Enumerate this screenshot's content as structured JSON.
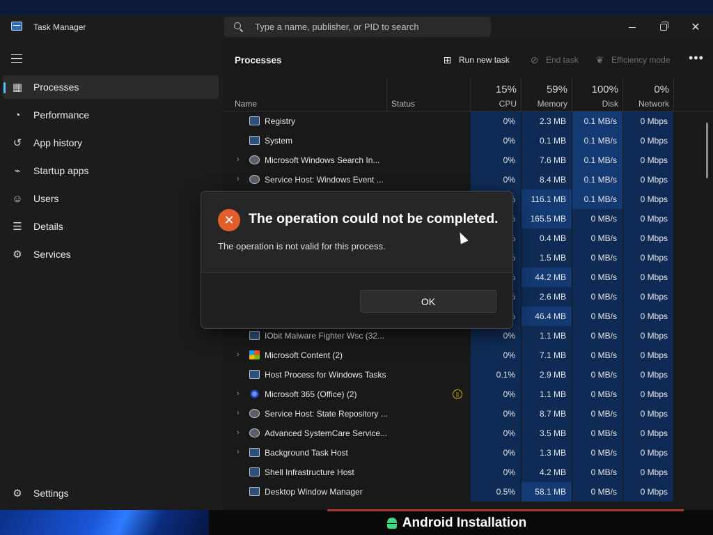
{
  "window": {
    "title": "Task Manager",
    "search_placeholder": "Type a name, publisher, or PID to search"
  },
  "sidebar": {
    "items": [
      {
        "label": "Processes",
        "icon": "processes-icon",
        "active": true
      },
      {
        "label": "Performance",
        "icon": "performance-icon"
      },
      {
        "label": "App history",
        "icon": "history-icon"
      },
      {
        "label": "Startup apps",
        "icon": "startup-icon"
      },
      {
        "label": "Users",
        "icon": "users-icon"
      },
      {
        "label": "Details",
        "icon": "details-icon"
      },
      {
        "label": "Services",
        "icon": "services-icon"
      }
    ],
    "settings_label": "Settings"
  },
  "toolbar": {
    "title": "Processes",
    "run_new_task": "Run new task",
    "end_task": "End task",
    "efficiency_mode": "Efficiency mode"
  },
  "table": {
    "headers": {
      "name": "Name",
      "status": "Status",
      "cpu_pct": "15%",
      "cpu": "CPU",
      "memory_pct": "59%",
      "memory": "Memory",
      "disk_pct": "100%",
      "disk": "Disk",
      "network_pct": "0%",
      "network": "Network"
    },
    "rows": [
      {
        "name": "Registry",
        "expand": false,
        "icon": "window",
        "cpu": "0%",
        "mem": "2.3 MB",
        "disk": "0.1 MB/s",
        "net": "0 Mbps"
      },
      {
        "name": "System",
        "expand": false,
        "icon": "window",
        "cpu": "0%",
        "mem": "0.1 MB",
        "disk": "0.1 MB/s",
        "net": "0 Mbps"
      },
      {
        "name": "Microsoft Windows Search In...",
        "expand": true,
        "icon": "gear",
        "cpu": "0%",
        "mem": "7.6 MB",
        "disk": "0.1 MB/s",
        "net": "0 Mbps"
      },
      {
        "name": "Service Host: Windows Event ...",
        "expand": true,
        "icon": "gear",
        "cpu": "0%",
        "mem": "8.4 MB",
        "disk": "0.1 MB/s",
        "net": "0 Mbps"
      },
      {
        "name": "",
        "expand": false,
        "icon": "none",
        "cpu": "%",
        "mem": "116.1 MB",
        "disk": "0.1 MB/s",
        "net": "0 Mbps"
      },
      {
        "name": "",
        "expand": false,
        "icon": "none",
        "cpu": "%",
        "mem": "165.5 MB",
        "disk": "0 MB/s",
        "net": "0 Mbps"
      },
      {
        "name": "",
        "expand": false,
        "icon": "none",
        "cpu": "%",
        "mem": "0.4 MB",
        "disk": "0 MB/s",
        "net": "0 Mbps"
      },
      {
        "name": "",
        "expand": false,
        "icon": "none",
        "cpu": "%",
        "mem": "1.5 MB",
        "disk": "0 MB/s",
        "net": "0 Mbps"
      },
      {
        "name": "",
        "expand": false,
        "icon": "none",
        "cpu": "%",
        "mem": "44.2 MB",
        "disk": "0 MB/s",
        "net": "0 Mbps"
      },
      {
        "name": "",
        "expand": false,
        "icon": "none",
        "cpu": "%",
        "mem": "2.6 MB",
        "disk": "0 MB/s",
        "net": "0 Mbps"
      },
      {
        "name": "",
        "expand": false,
        "icon": "none",
        "cpu": "%",
        "mem": "46.4 MB",
        "disk": "0 MB/s",
        "net": "0 Mbps"
      },
      {
        "name": "IObit Malware Fighter Wsc (32...",
        "expand": false,
        "icon": "window",
        "cpu": "0%",
        "mem": "1.1 MB",
        "disk": "0 MB/s",
        "net": "0 Mbps"
      },
      {
        "name": "Microsoft Content (2)",
        "expand": true,
        "icon": "ms",
        "cpu": "0%",
        "mem": "7.1 MB",
        "disk": "0 MB/s",
        "net": "0 Mbps"
      },
      {
        "name": "Host Process for Windows Tasks",
        "expand": false,
        "icon": "window",
        "cpu": "0.1%",
        "mem": "2.9 MB",
        "disk": "0 MB/s",
        "net": "0 Mbps"
      },
      {
        "name": "Microsoft 365 (Office) (2)",
        "expand": true,
        "icon": "o365",
        "status_icon": true,
        "cpu": "0%",
        "mem": "1.1 MB",
        "disk": "0 MB/s",
        "net": "0 Mbps"
      },
      {
        "name": "Service Host: State Repository ...",
        "expand": true,
        "icon": "gear",
        "cpu": "0%",
        "mem": "8.7 MB",
        "disk": "0 MB/s",
        "net": "0 Mbps"
      },
      {
        "name": "Advanced SystemCare Service...",
        "expand": true,
        "icon": "gear",
        "cpu": "0%",
        "mem": "3.5 MB",
        "disk": "0 MB/s",
        "net": "0 Mbps"
      },
      {
        "name": "Background Task Host",
        "expand": true,
        "icon": "window",
        "cpu": "0%",
        "mem": "1.3 MB",
        "disk": "0 MB/s",
        "net": "0 Mbps"
      },
      {
        "name": "Shell Infrastructure Host",
        "expand": false,
        "icon": "window",
        "cpu": "0%",
        "mem": "4.2 MB",
        "disk": "0 MB/s",
        "net": "0 Mbps"
      },
      {
        "name": "Desktop Window Manager",
        "expand": false,
        "icon": "window",
        "cpu": "0.5%",
        "mem": "58.1 MB",
        "disk": "0 MB/s",
        "net": "0 Mbps"
      }
    ]
  },
  "dialog": {
    "title": "The operation could not be completed.",
    "message": "The operation is not valid for this process.",
    "ok_label": "OK"
  },
  "banner": {
    "text": "Android Installation"
  },
  "colors": {
    "accent": "#4cc2ff",
    "error": "#e35e2d",
    "heat_low": "#0f2b55",
    "heat_high": "#143a74"
  }
}
